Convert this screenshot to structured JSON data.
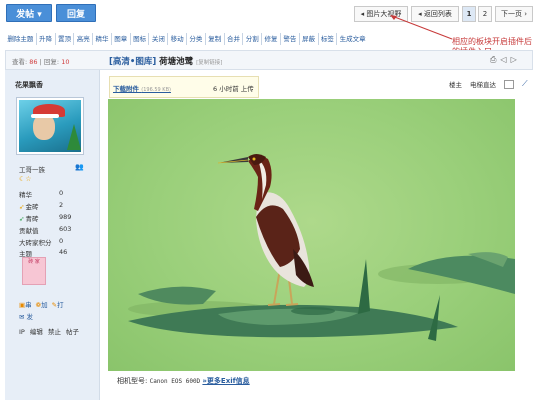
{
  "top_buttons": {
    "post": "发帖 ▾",
    "reply": "回复"
  },
  "pager": {
    "big_view": "◂ 图片大视野",
    "back_list": "◂ 返回列表",
    "page1": "1",
    "page2": "2",
    "next": "下一页 ›"
  },
  "toolbar": [
    "删除主题",
    "升降",
    "置顶",
    "高亮",
    "精华",
    "图章",
    "图标",
    "关闭",
    "移动",
    "分类",
    "复制",
    "合并",
    "分割",
    "修复",
    "警告",
    "屏蔽",
    "标签",
    "生成文章"
  ],
  "annotation": "相应的板块开启插件后的插件入口",
  "post_stats": {
    "views_label": "查看:",
    "views": "86",
    "sep": "|",
    "replies_label": "回复:",
    "replies": "10"
  },
  "post_title": {
    "tag": "[高清•图库]",
    "title": "荷塘池鹭",
    "copy": "[复制链接]"
  },
  "author": {
    "name": "花果飘香",
    "rank": "工哥一族",
    "rank_stars": "☾☆",
    "stats": [
      {
        "icon": "",
        "label": "精华",
        "value": "0"
      },
      {
        "icon": "➶",
        "label": "金砖",
        "value": "2"
      },
      {
        "icon": "➶",
        "label": "青砖",
        "value": "989"
      },
      {
        "icon": "",
        "label": "贡献值",
        "value": "603"
      },
      {
        "icon": "",
        "label": "大砖家积分",
        "value": "0"
      },
      {
        "icon": "",
        "label": "主题",
        "value": "46"
      }
    ],
    "medal": "砖 家",
    "actions_row1": [
      "串",
      "加",
      "打"
    ],
    "actions_row2": "发",
    "actions_row3": "IP 编辑 禁止 帖子"
  },
  "attachment": {
    "link": "下载附件",
    "size": "(196.59 KB)",
    "time": "6 小时前 上传"
  },
  "post_tools": {
    "owner": "楼主",
    "elevator": "电梯直达"
  },
  "exif": {
    "label": "相机型号:",
    "model": "Canon EOS 600D",
    "more": "»更多Exif信息"
  },
  "colors": {
    "accent_blue": "#4a8fd8",
    "link": "#2a5d9e",
    "annotation": "#c73a3a",
    "pond": "#9acf7a"
  }
}
